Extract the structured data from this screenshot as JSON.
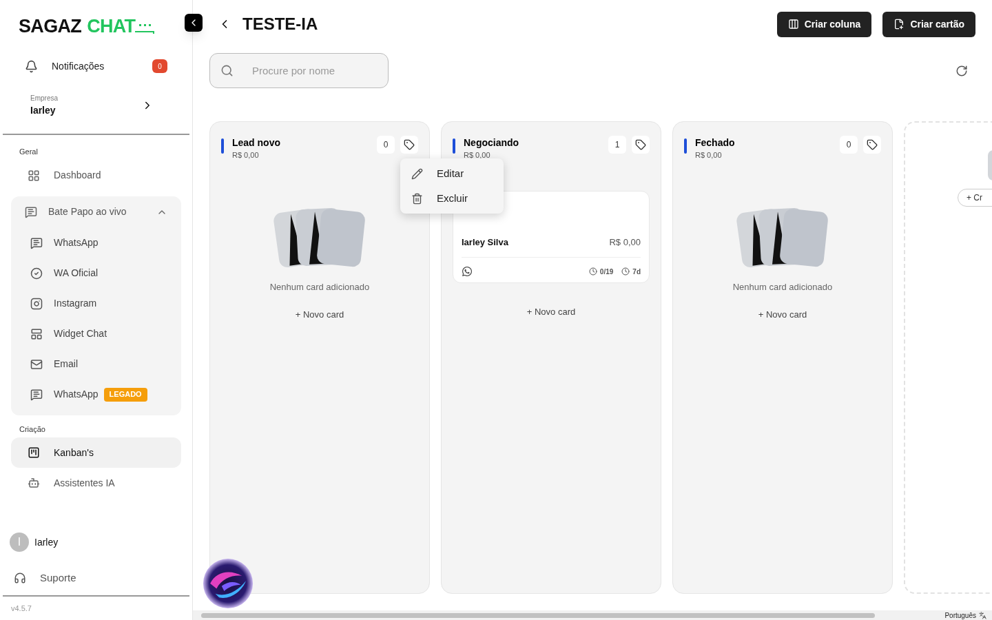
{
  "logo": {
    "part_1": "SAGAZ",
    "part_2": "CHAT"
  },
  "sidebar": {
    "notifications": {
      "label": "Notificações",
      "count": "0"
    },
    "company": {
      "caption": "Empresa",
      "name": "Iarley"
    },
    "sections": [
      {
        "title": "Geral",
        "items": [
          {
            "label": "Dashboard",
            "kind": "link",
            "selected": false
          }
        ]
      },
      {
        "items": [
          {
            "label": "Bate Papo ao vivo",
            "kind": "group",
            "expanded": true,
            "children": [
              {
                "label": "WhatsApp"
              },
              {
                "label": "WA Oficial"
              },
              {
                "label": "Instagram"
              },
              {
                "label": "Widget Chat"
              },
              {
                "label": "Email"
              },
              {
                "label": "WhatsApp",
                "badge": "LEGADO"
              }
            ]
          }
        ]
      },
      {
        "title": "Criação",
        "items": [
          {
            "label": "Kanban's",
            "kind": "link",
            "selected": true
          },
          {
            "label": "Assistentes IA",
            "kind": "link",
            "selected": false
          }
        ]
      }
    ],
    "user": {
      "initial": "I",
      "name": "Iarley"
    },
    "support": "Suporte",
    "version": "v4.5.7"
  },
  "header": {
    "title": "TESTE-IA",
    "buttons": [
      {
        "label": "Criar coluna",
        "kind": "column"
      },
      {
        "label": "Criar cartão",
        "kind": "card"
      }
    ]
  },
  "search": {
    "placeholder": "Procure por nome"
  },
  "columns": [
    {
      "title": "Lead novo",
      "total": "R$ 0,00",
      "count": "0",
      "empty_text": "Nenhum card adicionado",
      "add_label": "+ Novo card"
    },
    {
      "title": "Negociando",
      "total": "R$ 0,00",
      "count": "1",
      "add_label": "+ Novo card",
      "cards": [
        {
          "name": "Iarley Silva",
          "value": "R$ 0,00",
          "tasks": "0/19",
          "age": "7d"
        }
      ]
    },
    {
      "title": "Fechado",
      "total": "R$ 0,00",
      "count": "0",
      "empty_text": "Nenhum card adicionado",
      "add_label": "+ Novo card"
    }
  ],
  "new_column": {
    "button": "+ Cr"
  },
  "context_menu": {
    "items": [
      {
        "label": "Editar",
        "kind": "edit"
      },
      {
        "label": "Excluir",
        "kind": "delete"
      }
    ]
  },
  "language": "Português"
}
